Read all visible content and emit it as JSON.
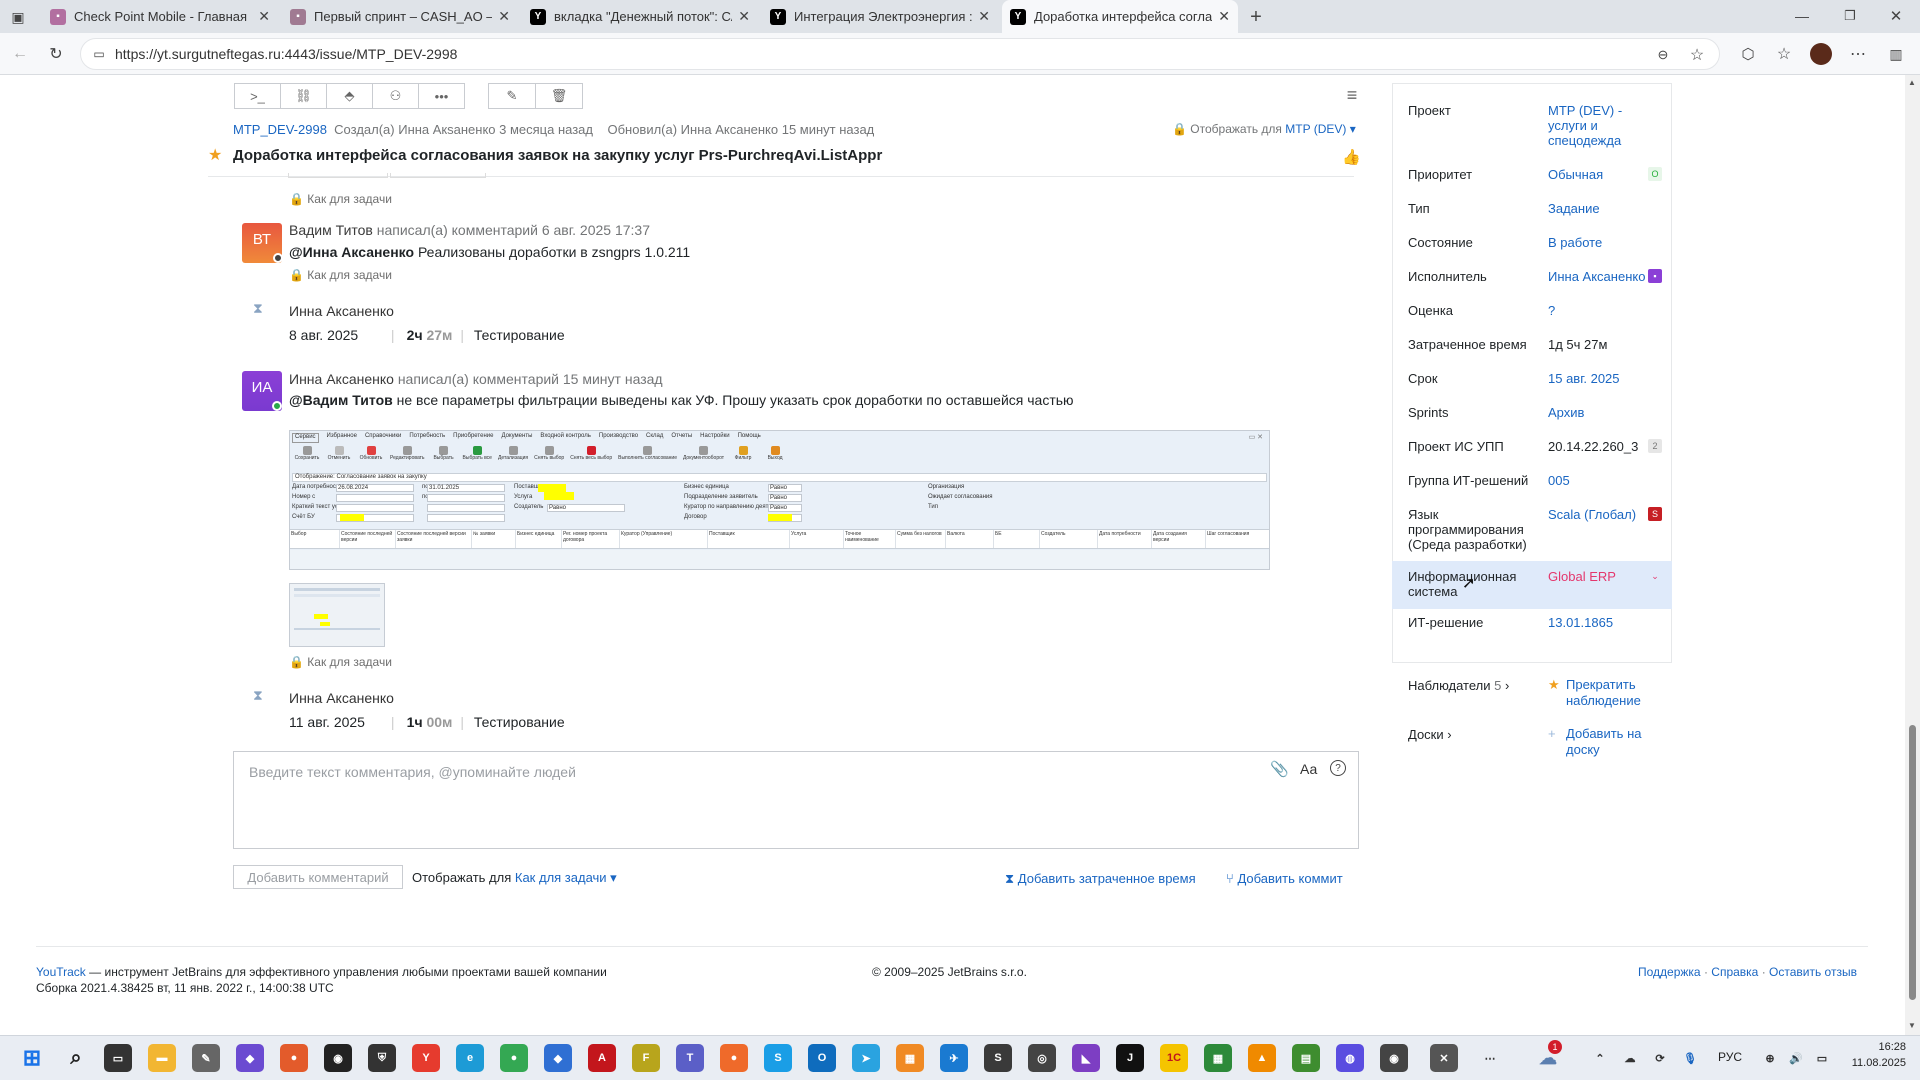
{
  "browser": {
    "tabs": [
      {
        "title": "Check Point Mobile - Главная",
        "favicon": "checkpoint-icon",
        "active": false
      },
      {
        "title": "Первый спринт – CASH_AO – Д",
        "favicon": "doc-icon",
        "active": false
      },
      {
        "title": "вкладка \"Денежный поток\": CA",
        "favicon": "youtrack-icon",
        "active": false
      },
      {
        "title": "Интеграция Электроэнергия : M",
        "favicon": "youtrack-icon",
        "active": false
      },
      {
        "title": "Доработка интерфейса согласо",
        "favicon": "youtrack-icon",
        "active": true
      }
    ],
    "url": "https://yt.surgutneftegas.ru:4443/issue/MTP_DEV-2998"
  },
  "issue": {
    "id": "MTP_DEV-2998",
    "created": "Создал(а) Инна Акsаненко 3 месяца назад",
    "updated": "Обновил(а) Инна Аксаненко 15 минут назад",
    "visibility_prefix": "Отображать для",
    "visibility_value": "MTP (DEV)",
    "title": "Доработка интерфейса согласования заявок на закупку услуг Prs-PurchreqAvi.ListAppr"
  },
  "activity": {
    "lock_label_1": "Как для задачи",
    "comment1": {
      "avatar_initials": "ВТ",
      "author": "Вадим Титов",
      "meta": "написал(а) комментарий 6 авг. 2025 17:37",
      "mention": "@Инна Аксаненко",
      "text": "Реализованы доработки в zsngprs 1.0.211",
      "visibility": "Как для задачи"
    },
    "work1": {
      "author": "Инна Аксаненко",
      "date": "8 авг. 2025",
      "hours": "2ч",
      "minutes": "27м",
      "type": "Тестирование"
    },
    "comment2": {
      "avatar_initials": "ИА",
      "author": "Инна Аксаненко",
      "meta": "написал(а) комментарий 15 минут назад",
      "mention": "@Вадим Титов",
      "text": "не все параметры фильтрации выведены как УФ. Прошу указать срок доработки по оставшейся частью",
      "visibility": "Как для задачи"
    },
    "work2": {
      "author": "Инна Аксаненко",
      "date": "11 авг. 2025",
      "hours": "1ч",
      "minutes": "00м",
      "type": "Тестирование"
    }
  },
  "screenshot_menu": [
    "Сервис",
    "Избранное",
    "Справочники",
    "Потребность",
    "Приобретение",
    "Документы",
    "Входной контроль",
    "Производство",
    "Склад",
    "Отчеты",
    "Настройки",
    "Помощь"
  ],
  "screenshot_toolbar": [
    "Сохранить",
    "Отменить",
    "Обновить",
    "Редактировать",
    "Выбрать",
    "Выбрать все",
    "Детализация",
    "Снять выбор",
    "Снять весь выбор",
    "Выполнить согласование",
    "Документооборот",
    "Фильтр",
    "Выход"
  ],
  "screenshot_form": {
    "display_label": "Отображение:",
    "display_value": "Согласование заявок на закупку",
    "rows": [
      {
        "label": "Дата потребности с",
        "v1": "26.08.2024",
        "to": "по",
        "v2": "31.01.2025",
        "f2": "Поставщик",
        "f3": "Бизнес единица",
        "f3v": "Равно",
        "f4": "Организация"
      },
      {
        "label": "Номер с",
        "v1": "",
        "to": "по",
        "v2": "",
        "f2": "Услуга",
        "f3": "Подразделение заявитель",
        "f3v": "Равно",
        "f4": "Ожидает согласования"
      },
      {
        "label": "Краткий текст услуги",
        "v1": "",
        "to": "",
        "v2": "",
        "f2": "Создатель",
        "f2v": "Равно",
        "f3": "Куратор по направлению деятельности",
        "f3v": "Равно",
        "f4": "Тип"
      },
      {
        "label": "Счёт БУ",
        "v1": "",
        "to": "",
        "v2": "",
        "f2": "",
        "f3": "Договор",
        "f3v": "",
        "f4": ""
      }
    ],
    "columns": [
      "Выбор",
      "Состояние последней версии",
      "Состояние последней версии заявки",
      "№ заявки",
      "Бизнес единица",
      "Рег. номер проекта договора",
      "Куратор (Управление)",
      "Поставщик",
      "Услуга",
      "Точное наименование",
      "Сумма без налогов",
      "Валюта",
      "БЕ",
      "Создатель",
      "Дата потребности",
      "Дата создания версии",
      "Шаг согласования"
    ]
  },
  "comment_box": {
    "placeholder": "Введите текст комментария, @упоминайте людей",
    "format_label": "Аа",
    "submit_label": "Добавить комментарий",
    "visibility_prefix": "Отображать для",
    "visibility_value": "Как для задачи",
    "add_time_label": "Добавить затраченное время",
    "add_commit_label": "Добавить коммит"
  },
  "fields": [
    {
      "label": "Проект",
      "value": "MTP (DEV) - услуги и спецодежда"
    },
    {
      "label": "Приоритет",
      "value": "Обычная",
      "badge": "O",
      "badge_color": "#ffffff",
      "badge_text_color": "#25b03a"
    },
    {
      "label": "Тип",
      "value": "Задание"
    },
    {
      "label": "Состояние",
      "value": "В работе"
    },
    {
      "label": "Исполнитель",
      "value": "Инна Аксаненко"
    },
    {
      "label": "Оценка",
      "value": "?"
    },
    {
      "label": "Затраченное время",
      "value": "1д 5ч 27м"
    },
    {
      "label": "Срок",
      "value": "15 авг. 2025"
    },
    {
      "label": "Sprints",
      "value": "Архив"
    },
    {
      "label": "Проект ИС УПП",
      "value": "20.14.22.260_3",
      "badge": "2"
    },
    {
      "label": "Группа ИТ-решений",
      "value": "005"
    },
    {
      "label": "Язык программирования (Среда разработки)",
      "value": "Scala (Глобал)",
      "badge": "S"
    },
    {
      "label": "Информационная система",
      "value": "Global ERP"
    },
    {
      "label": "ИТ-решение",
      "value": "13.01.1865"
    }
  ],
  "watchers": {
    "label": "Наблюдатели",
    "count": "5",
    "action": "Прекратить наблюдение"
  },
  "boards": {
    "label": "Доски",
    "action": "Добавить на доску"
  },
  "footer": {
    "brand": "YouTrack",
    "tagline": "— инструмент JetBrains для эффективного управления любыми проектами вашей компании",
    "build": "Сборка 2021.4.38425 вт, 11 янв. 2022 г., 14:00:38 UTC",
    "copyright": "© 2009–2025 JetBrains s.r.o.",
    "support": "Поддержка",
    "help": "Справка",
    "feedback": "Оставить отзыв"
  },
  "taskbar": {
    "lang": "РУС",
    "time": "16:28",
    "date": "11.08.2025",
    "notif_badge": "1"
  },
  "colors": {
    "accent": "#1a66c2",
    "pink_value": "#e4376d",
    "avatar_vt": "#e8573f",
    "avatar_ia": "#8b3fd6"
  }
}
